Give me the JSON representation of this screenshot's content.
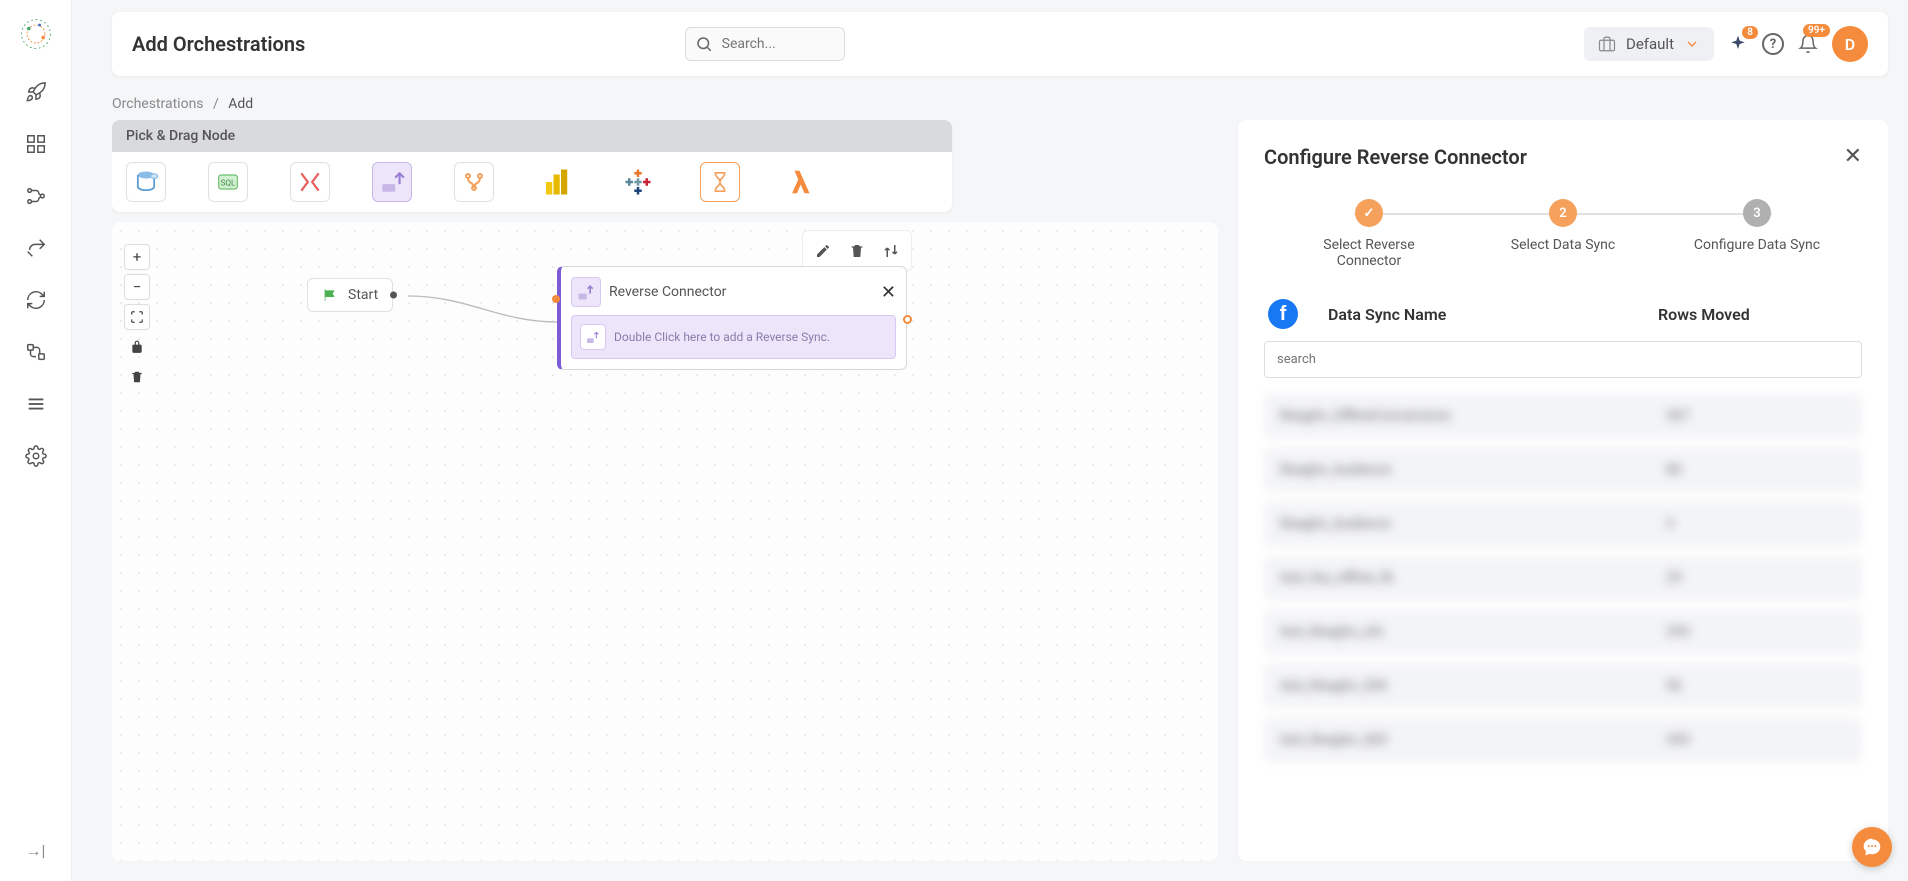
{
  "header": {
    "title": "Add Orchestrations",
    "search_placeholder": "Search...",
    "workspace": "Default",
    "sparkle_badge": "8",
    "notif_badge": "99+",
    "avatar_initial": "D"
  },
  "breadcrumb": {
    "parent": "Orchestrations",
    "current": "Add"
  },
  "palette": {
    "header": "Pick & Drag Node"
  },
  "canvas": {
    "start_label": "Start",
    "connector_title": "Reverse Connector",
    "connector_hint": "Double Click here to add a Reverse Sync."
  },
  "panel": {
    "title": "Configure Reverse Connector",
    "steps": [
      {
        "num": "✓",
        "label": "Select Reverse Connector",
        "state": "done"
      },
      {
        "num": "2",
        "label": "Select Data Sync",
        "state": "active"
      },
      {
        "num": "3",
        "label": "Configure Data Sync",
        "state": "pending"
      }
    ],
    "col_name": "Data Sync Name",
    "col_rows": "Rows Moved",
    "search_placeholder": "search",
    "rows": [
      {
        "name": "Reaghn_OfflineConversions",
        "rows": "307"
      },
      {
        "name": "Reaghn_Audience",
        "rows": "80"
      },
      {
        "name": "Reaghn_Audience",
        "rows": "3"
      },
      {
        "name": "test_fea_offline_fb",
        "rows": "29"
      },
      {
        "name": "test_Reaghn_ofn",
        "rows": "293"
      },
      {
        "name": "test_Reaghn_284",
        "rows": "56"
      },
      {
        "name": "test_Reaghn_365",
        "rows": "343"
      }
    ]
  }
}
